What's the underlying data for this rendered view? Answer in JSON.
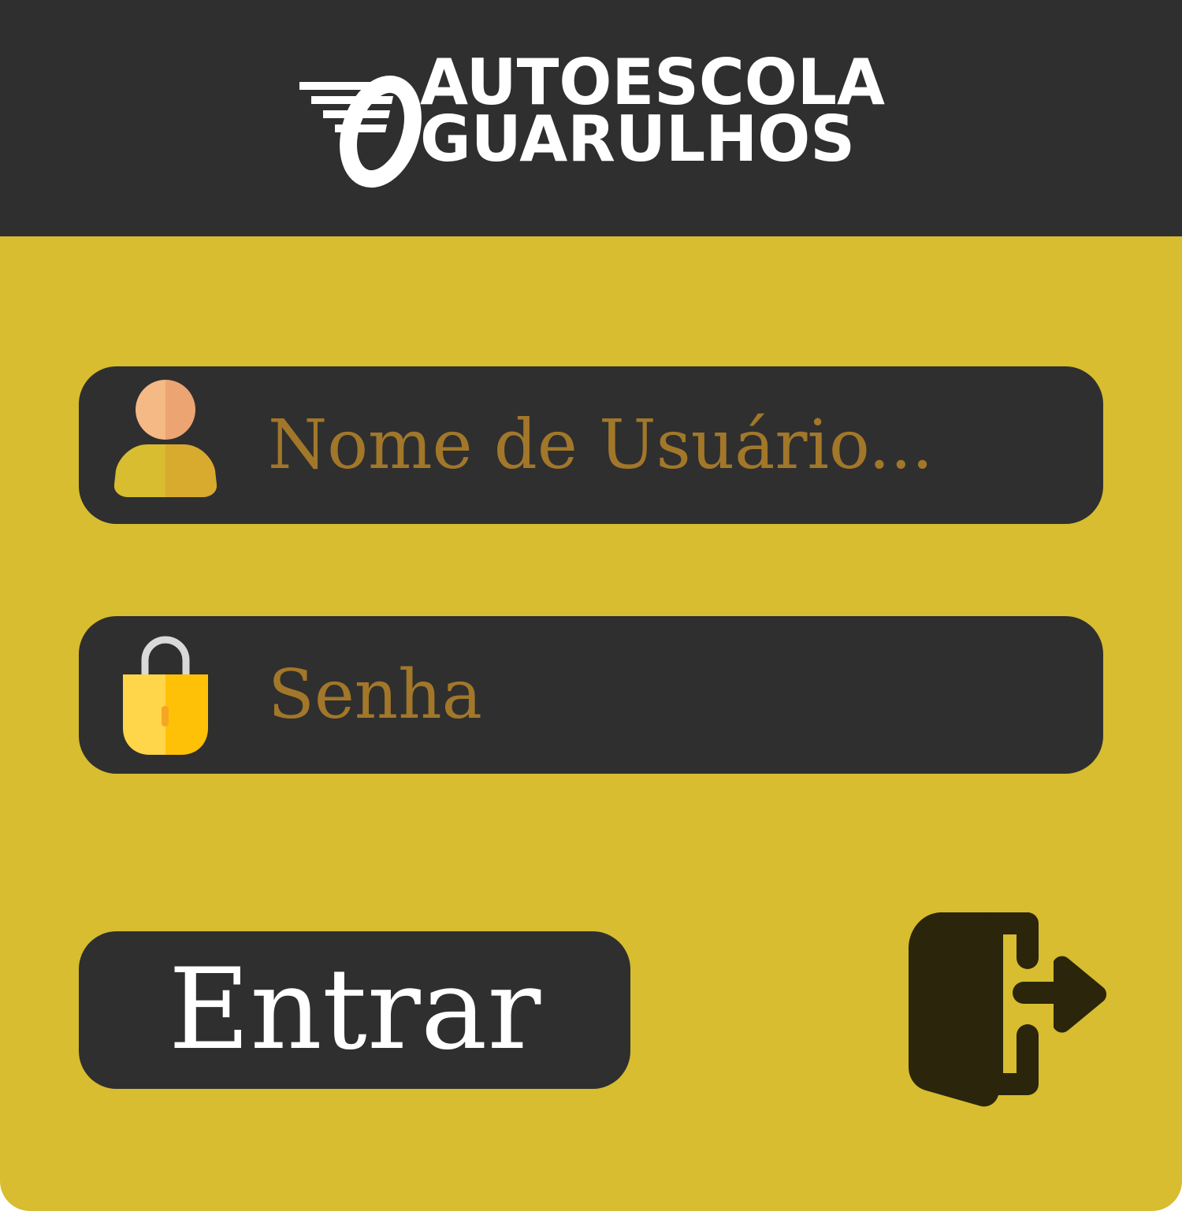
{
  "header": {
    "logo_line1": "AUTOESCOLA",
    "logo_line2": "GUARULHOS"
  },
  "login": {
    "username": {
      "value": "",
      "placeholder": "Nome de Usuário..."
    },
    "password": {
      "value": "",
      "placeholder": "Senha"
    },
    "submit_label": "Entrar"
  },
  "icons": {
    "username": "user-icon",
    "password": "lock-icon",
    "exit": "exit-door-icon"
  },
  "colors": {
    "background": "#d7bd2f",
    "header": "#2f2f2f",
    "field": "#2f2f2f",
    "placeholder_text": "#a2772a",
    "button_text": "#ffffff",
    "exit_icon": "#2b250c"
  }
}
